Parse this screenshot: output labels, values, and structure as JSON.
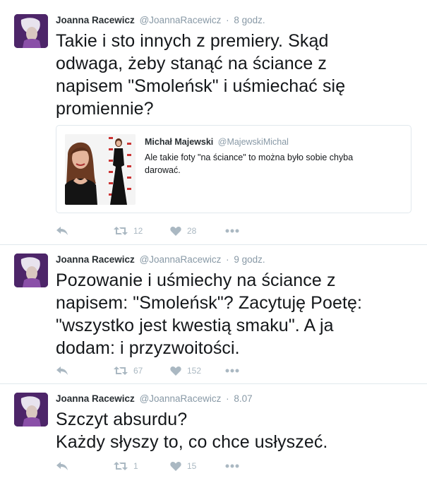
{
  "tweets": [
    {
      "author": {
        "name": "Joanna Racewicz",
        "handle": "@JoannaRacewicz"
      },
      "separator": "·",
      "time": "8 godz.",
      "text_lines": [
        "Takie i sto innych z premiery. Skąd",
        "odwaga, żeby stanąć na ściance z",
        "napisem \"Smoleńsk\" i uśmiechać się",
        "promiennie?"
      ],
      "quote": {
        "author": {
          "name": "Michał Majewski",
          "handle": "@MajewskiMichal"
        },
        "text_lines": [
          "Ale takie foty \"na ściance\" to można było sobie chyba",
          "darować."
        ]
      },
      "stats": {
        "retweets": "12",
        "likes": "28"
      }
    },
    {
      "author": {
        "name": "Joanna Racewicz",
        "handle": "@JoannaRacewicz"
      },
      "separator": "·",
      "time": "9 godz.",
      "text_lines": [
        "Pozowanie i uśmiechy na ściance z",
        "napisem: \"Smoleńsk\"? Zacytuję Poetę:",
        "\"wszystko jest kwestią smaku\". A ja",
        "dodam: i przyzwoitości."
      ],
      "stats": {
        "retweets": "67",
        "likes": "152"
      }
    },
    {
      "author": {
        "name": "Joanna Racewicz",
        "handle": "@JoannaRacewicz"
      },
      "separator": "·",
      "time": "8.07",
      "text_lines": [
        "Szczyt absurdu?",
        "Każdy słyszy to, co chce usłyszeć."
      ],
      "stats": {
        "retweets": "1",
        "likes": "15"
      }
    }
  ],
  "icons": {
    "reply": "reply-icon",
    "retweet": "retweet-icon",
    "like": "heart-icon",
    "more": "more-dots-icon"
  },
  "colors": {
    "text": "#14171a",
    "secondary": "#8899a6",
    "action_icon": "#aab8c2",
    "divider": "#e1e8ed",
    "avatar_bg": "#3a1c52"
  }
}
